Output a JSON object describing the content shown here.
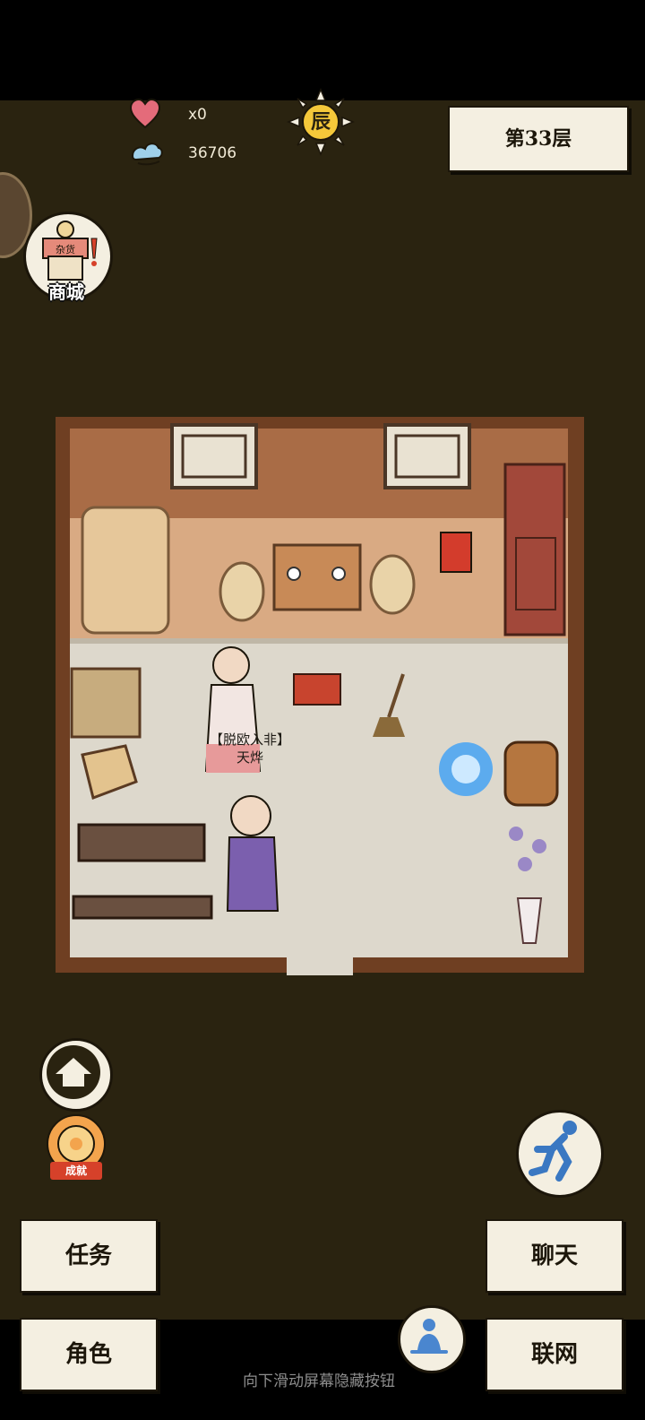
{
  "hud": {
    "hearts_count": "x0",
    "spirit_count": "36706",
    "time_label": "辰",
    "floor_label": "第33层"
  },
  "shop": {
    "label": "商城",
    "sign_text": "杂货"
  },
  "achievement": {
    "label": "成就"
  },
  "character": {
    "title": "【脱欧入非】",
    "name": "天烨"
  },
  "buttons": {
    "task": "任务",
    "role": "角色",
    "chat": "聊天",
    "network": "联网"
  },
  "hint": "向下滑动屏幕隐藏按钮"
}
